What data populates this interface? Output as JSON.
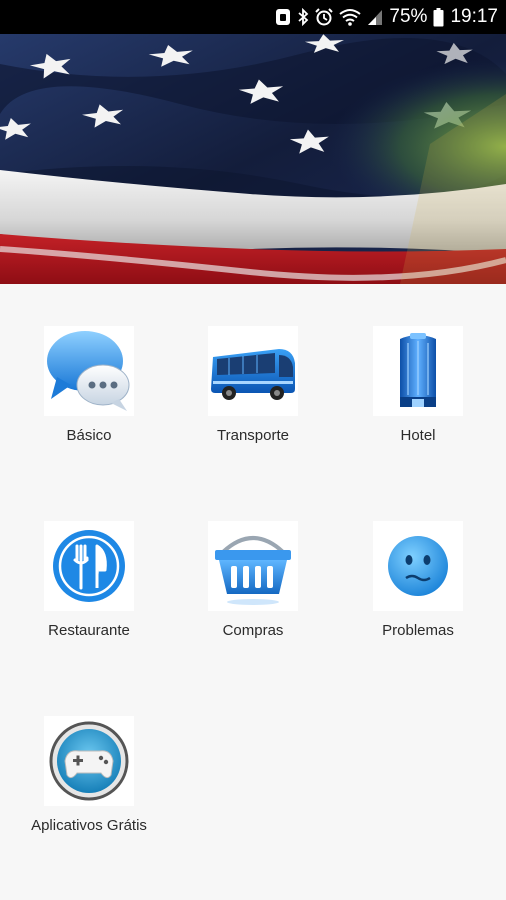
{
  "status_bar": {
    "battery_percent": "75%",
    "time": "19:17",
    "icons": [
      "notification-icon",
      "bluetooth-icon",
      "alarm-icon",
      "wifi-icon",
      "cellular-signal-icon",
      "battery-icon"
    ]
  },
  "banner": {
    "image": "american-flag"
  },
  "menu": {
    "items": [
      {
        "label": "Básico",
        "icon": "chat-bubbles-icon"
      },
      {
        "label": "Transporte",
        "icon": "bus-icon"
      },
      {
        "label": "Hotel",
        "icon": "hotel-building-icon"
      },
      {
        "label": "Restaurante",
        "icon": "fork-knife-icon"
      },
      {
        "label": "Compras",
        "icon": "shopping-basket-icon"
      },
      {
        "label": "Problemas",
        "icon": "sad-face-icon"
      },
      {
        "label": "Aplicativos Grátis",
        "icon": "gamepad-icon"
      }
    ]
  },
  "colors": {
    "accent_blue": "#1e88e5",
    "status_bar": "#000000",
    "background": "#f7f7f7"
  }
}
